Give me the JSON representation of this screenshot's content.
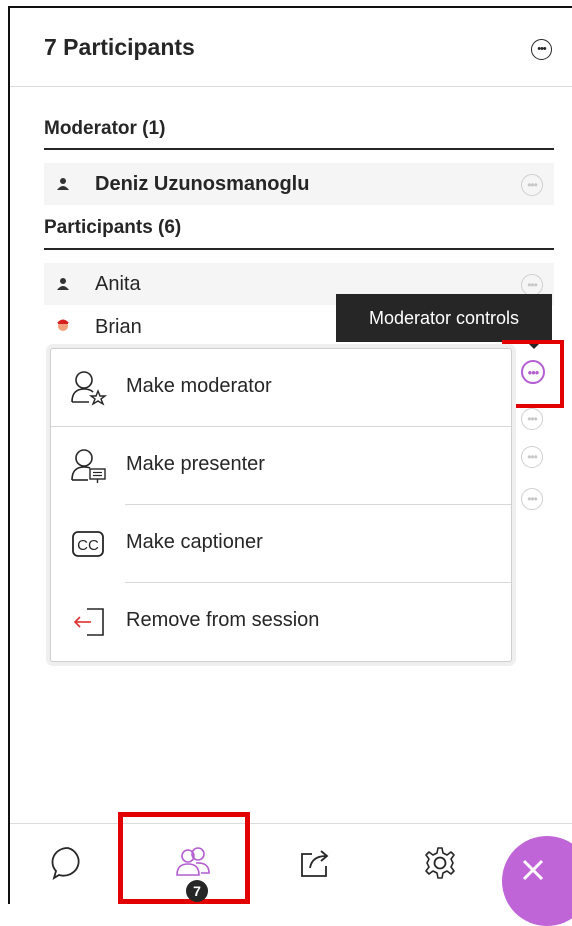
{
  "header": {
    "title": "7 Participants"
  },
  "sections": {
    "moderator_heading": "Moderator (1)",
    "participants_heading": "Participants (6)"
  },
  "moderators": [
    {
      "name": "Deniz Uzunosmanoglu",
      "avatar": "person-icon"
    }
  ],
  "participants": [
    {
      "name": "Anita",
      "avatar": "person-icon"
    },
    {
      "name": "Brian",
      "avatar": "photo-avatar"
    }
  ],
  "tooltip": {
    "text": "Moderator controls"
  },
  "menu": {
    "items": [
      {
        "label": "Make moderator",
        "icon": "make-moderator-icon"
      },
      {
        "label": "Make presenter",
        "icon": "make-presenter-icon"
      },
      {
        "label": "Make captioner",
        "icon": "closed-captions-icon"
      },
      {
        "label": "Remove from session",
        "icon": "remove-from-session-icon"
      }
    ]
  },
  "toolbar": {
    "items": [
      "chat-icon",
      "participants-icon",
      "share-content-icon",
      "settings-icon",
      "close-icon"
    ],
    "participants_badge": "7"
  },
  "colors": {
    "accent": "#c065d7",
    "highlight": "#e30000",
    "tooltip_bg": "#262626",
    "text": "#262626"
  }
}
